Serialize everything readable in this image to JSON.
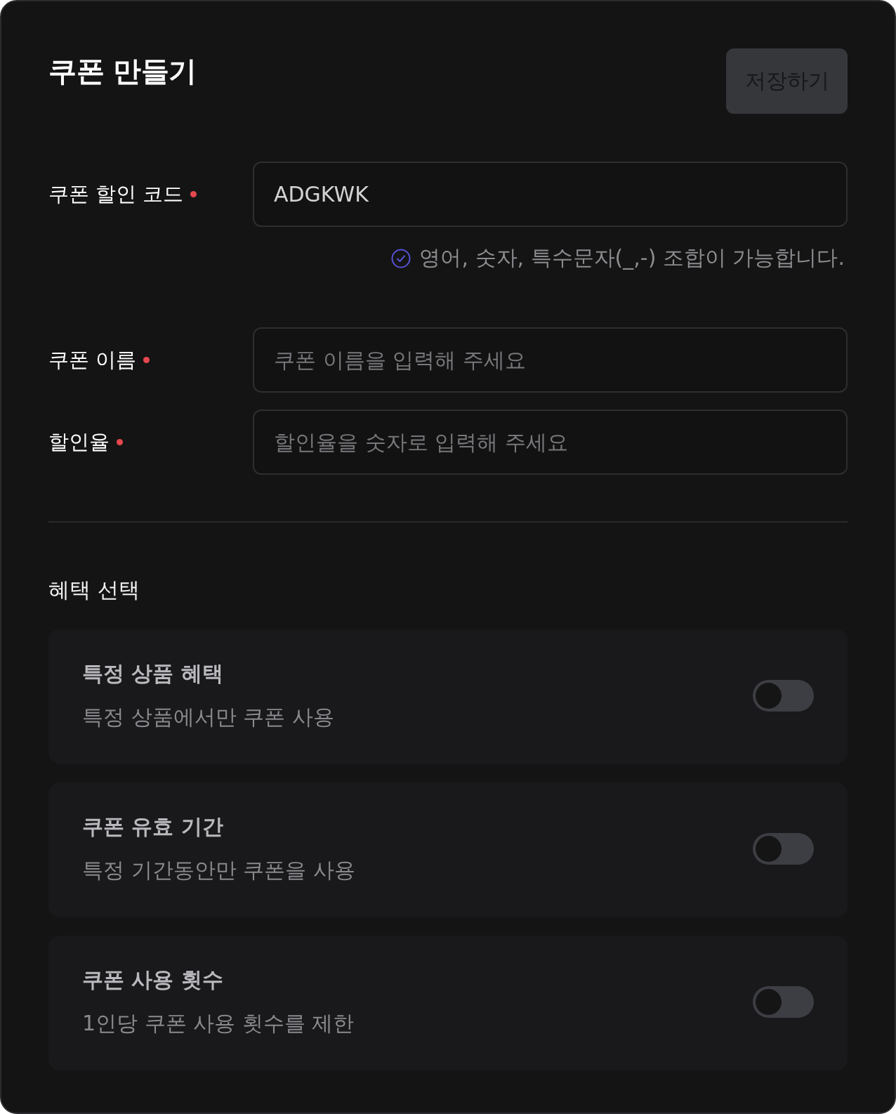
{
  "header": {
    "title": "쿠폰 만들기",
    "save_button": {
      "label": "저장하기",
      "disabled": true
    }
  },
  "fields": [
    {
      "label": "쿠폰 할인 코드",
      "required": true,
      "value": "ADGKWK",
      "hint": "영어, 숫자, 특수문자(_,-) 조합이 가능합니다."
    },
    {
      "label": "쿠폰 이름",
      "required": true,
      "placeholder": "쿠폰 이름을 입력해 주세요"
    },
    {
      "label": "할인율",
      "required": true,
      "placeholder": "할인율을 숫자로 입력해 주세요"
    }
  ],
  "benefits": {
    "title": "혜택 선택",
    "options": [
      {
        "title": "특정 상품 혜택",
        "description": "특정 상품에서만 쿠폰 사용",
        "on": false
      },
      {
        "title": "쿠폰 유효 기간",
        "description": "특정 기간동안만 쿠폰을 사용",
        "on": false
      },
      {
        "title": "쿠폰 사용 횟수",
        "description": "1인당 쿠폰 사용 횟수를 제한",
        "on": false
      }
    ]
  }
}
